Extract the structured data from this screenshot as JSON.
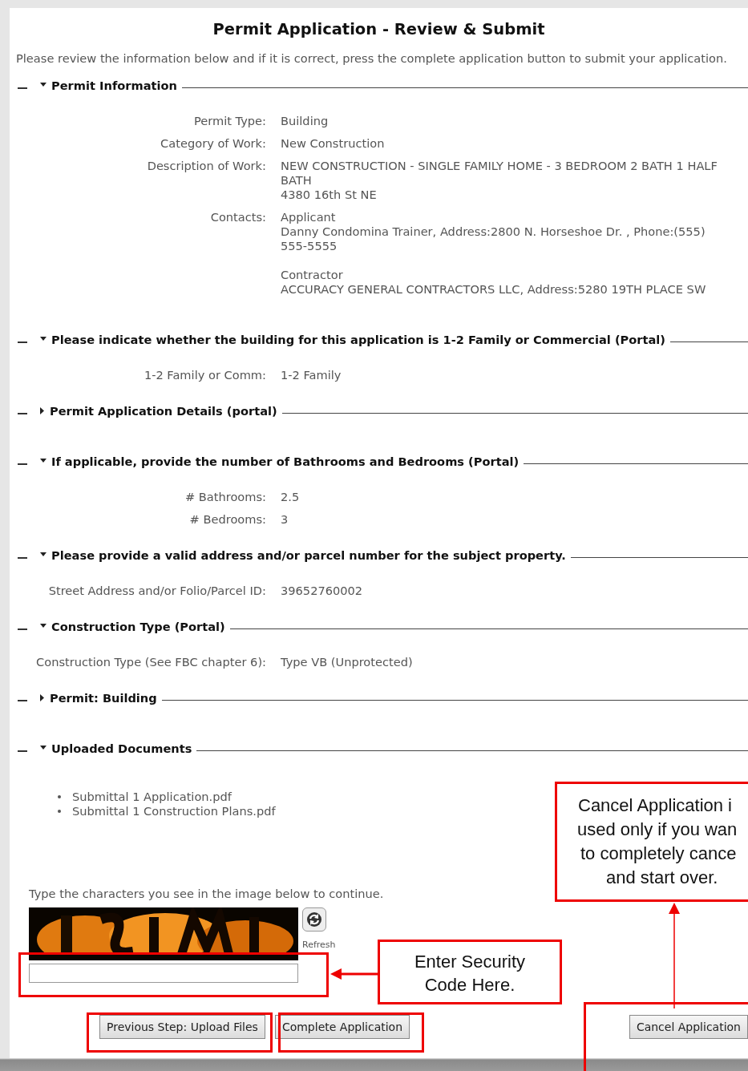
{
  "page": {
    "title": "Permit Application - Review & Submit",
    "intro": "Please review the information below and if it is correct, press the complete application button to submit your application."
  },
  "sections": [
    {
      "title": "Permit Information",
      "expanded": true,
      "fields": [
        {
          "label": "Permit Type:",
          "values": [
            [
              "Building"
            ]
          ]
        },
        {
          "label": "Category of Work:",
          "values": [
            [
              "New Construction"
            ]
          ]
        },
        {
          "label": "Description of Work:",
          "values": [
            [
              "NEW CONSTRUCTION - SINGLE FAMILY HOME - 3 BEDROOM 2 BATH 1 HALF BATH",
              "4380 16th St NE"
            ]
          ]
        },
        {
          "label": "Contacts:",
          "values": [
            [
              "Applicant",
              "Danny Condomina Trainer, Address:2800 N. Horseshoe Dr. , Phone:(555) 555-5555"
            ],
            [
              "Contractor",
              "ACCURACY GENERAL CONTRACTORS LLC, Address:5280 19TH PLACE SW"
            ]
          ]
        }
      ]
    },
    {
      "title": "Please indicate whether the building for this application is 1-2 Family or Commercial (Portal)",
      "expanded": true,
      "fields": [
        {
          "label": "1-2 Family or Comm:",
          "values": [
            [
              "1-2 Family"
            ]
          ]
        }
      ]
    },
    {
      "title": "Permit Application Details (portal)",
      "expanded": false
    },
    {
      "title": "If applicable, provide the number of Bathrooms and Bedrooms (Portal)",
      "expanded": true,
      "fields": [
        {
          "label": "# Bathrooms:",
          "values": [
            [
              "2.5"
            ]
          ]
        },
        {
          "label": "# Bedrooms:",
          "values": [
            [
              "3"
            ]
          ]
        }
      ]
    },
    {
      "title": "Please provide a valid address and/or parcel number for the subject property.",
      "expanded": true,
      "fields": [
        {
          "label": "Street Address and/or Folio/Parcel ID:",
          "values": [
            [
              "39652760002"
            ]
          ]
        }
      ]
    },
    {
      "title": "Construction Type (Portal)",
      "expanded": true,
      "fields": [
        {
          "label": "Construction Type (See FBC chapter 6):",
          "values": [
            [
              "Type VB (Unprotected)"
            ]
          ]
        }
      ]
    },
    {
      "title": "Permit: Building",
      "expanded": false
    },
    {
      "title": "Uploaded Documents",
      "expanded": true,
      "documents": [
        "Submittal 1 Application.pdf",
        "Submittal 1 Construction Plans.pdf"
      ]
    }
  ],
  "captcha": {
    "instruction": "Type the characters you see in the image below to continue.",
    "refresh_label": "Refresh"
  },
  "buttons": [
    "Previous Step: Upload Files",
    "Complete Application"
  ],
  "cancel_button": "Cancel Application",
  "annotations": [
    {
      "kind": "cancel-note",
      "lines": [
        "Cancel Application i",
        "used only if you wan",
        "to completely cance",
        "and start over."
      ]
    },
    {
      "kind": "code-note",
      "lines": [
        "Enter Security",
        "Code Here."
      ]
    }
  ]
}
